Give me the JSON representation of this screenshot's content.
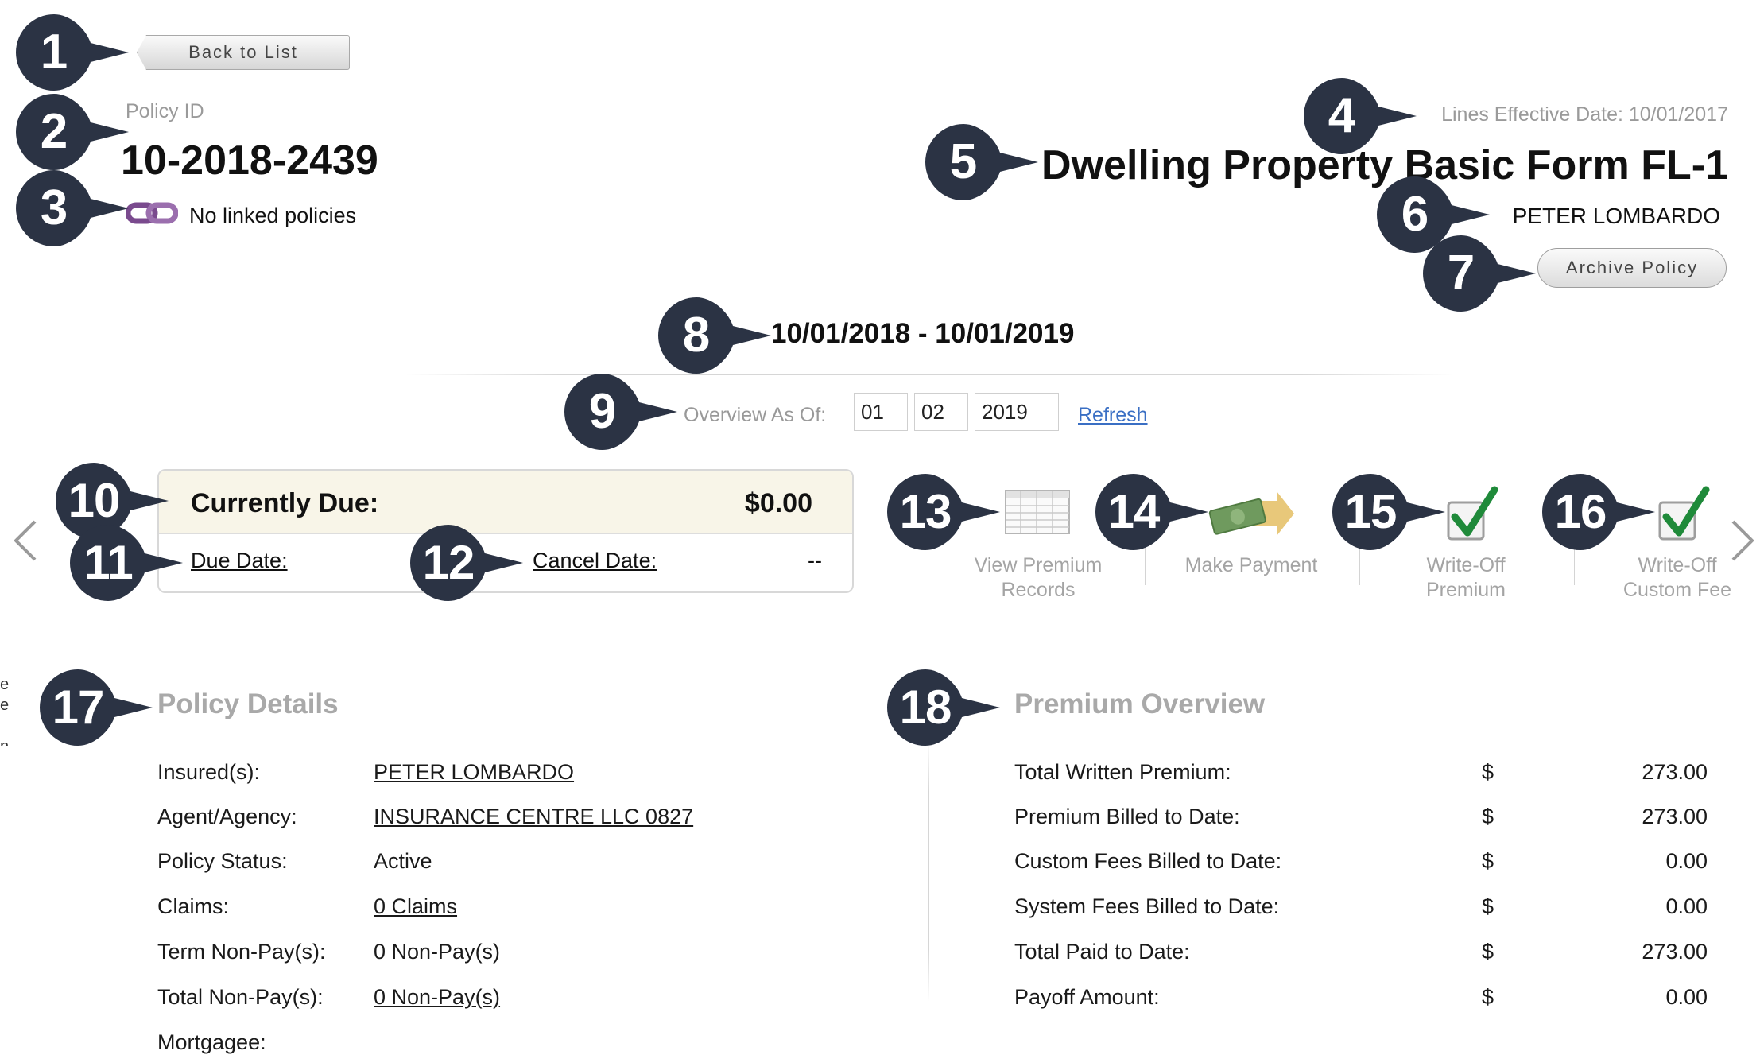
{
  "header": {
    "back_button": "Back to List",
    "policy_id_label": "Policy ID",
    "policy_id": "10-2018-2439",
    "linked_policies": "No linked policies",
    "lines_effective_date": "Lines Effective Date: 10/01/2017",
    "policy_form": "Dwelling Property Basic Form FL-1",
    "insured_name": "PETER LOMBARDO",
    "archive_button": "Archive Policy",
    "term_range": "10/01/2018 - 10/01/2019"
  },
  "overview": {
    "label": "Overview As Of:",
    "month": "01",
    "day": "02",
    "year": "2019",
    "refresh_link": "Refresh"
  },
  "due_panel": {
    "currently_due_label": "Currently Due:",
    "currently_due_value": "$0.00",
    "due_date_label": "Due Date:",
    "cancel_date_label": "Cancel Date:",
    "cancel_date_value": "--"
  },
  "actions": [
    {
      "line1": "View Premium",
      "line2": "Records",
      "icon": "spreadsheet-icon"
    },
    {
      "line1": "Make Payment",
      "line2": "",
      "icon": "money-arrow-icon"
    },
    {
      "line1": "Write-Off",
      "line2": "Premium",
      "icon": "checkbox-check-icon"
    },
    {
      "line1": "Write-Off",
      "line2": "Custom Fee",
      "icon": "checkbox-check-icon"
    }
  ],
  "policy_details": {
    "title": "Policy Details",
    "rows": [
      {
        "label": "Insured(s):",
        "value": "PETER LOMBARDO"
      },
      {
        "label": "Agent/Agency:",
        "value": "INSURANCE CENTRE LLC 0827"
      },
      {
        "label": "Policy Status:",
        "value": "Active"
      },
      {
        "label": "Claims:",
        "value": "0 Claims"
      },
      {
        "label": "Term Non-Pay(s):",
        "value": "0 Non-Pay(s)"
      },
      {
        "label": "Total Non-Pay(s):",
        "value": "0 Non-Pay(s)"
      },
      {
        "label": "Mortgagee:",
        "value": ""
      }
    ]
  },
  "premium_overview": {
    "title": "Premium Overview",
    "currency": "$",
    "rows": [
      {
        "label": "Total Written Premium:",
        "value": "273.00"
      },
      {
        "label": "Premium Billed to Date:",
        "value": "273.00"
      },
      {
        "label": "Custom Fees Billed to Date:",
        "value": "0.00"
      },
      {
        "label": "System Fees Billed to Date:",
        "value": "0.00"
      },
      {
        "label": "Total Paid to Date:",
        "value": "273.00"
      },
      {
        "label": "Payoff Amount:",
        "value": "0.00"
      }
    ]
  },
  "markers": [
    "1",
    "2",
    "3",
    "4",
    "5",
    "6",
    "7",
    "8",
    "9",
    "10",
    "11",
    "12",
    "13",
    "14",
    "15",
    "16",
    "17",
    "18"
  ],
  "colors": {
    "marker": "#2b3344",
    "link": "#3a6fc4",
    "panel_header": "#f8f5e8",
    "check_green": "#1f8a3a"
  }
}
